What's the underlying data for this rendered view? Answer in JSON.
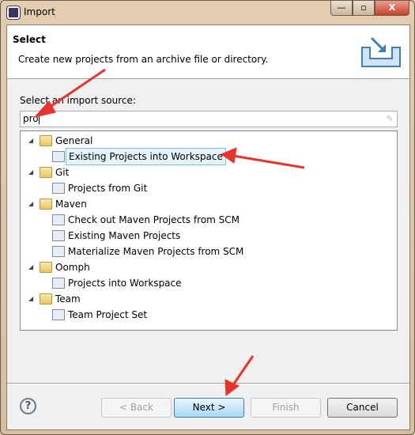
{
  "window": {
    "title": "Import",
    "minimize": "—",
    "maximize": "▫",
    "close": "X"
  },
  "header": {
    "title": "Select",
    "description": "Create new projects from an archive file or directory.",
    "icon": "import-wizard-icon"
  },
  "source": {
    "label": "Select an import source:",
    "filter_value": "pro"
  },
  "tree": [
    {
      "label": "General",
      "level": 0,
      "type": "folder",
      "expanded": true
    },
    {
      "label": "Existing Projects into Workspace",
      "level": 1,
      "type": "item",
      "selected": true
    },
    {
      "label": "Git",
      "level": 0,
      "type": "folder",
      "expanded": true
    },
    {
      "label": "Projects from Git",
      "level": 1,
      "type": "item"
    },
    {
      "label": "Maven",
      "level": 0,
      "type": "folder",
      "expanded": true
    },
    {
      "label": "Check out Maven Projects from SCM",
      "level": 1,
      "type": "item"
    },
    {
      "label": "Existing Maven Projects",
      "level": 1,
      "type": "item"
    },
    {
      "label": "Materialize Maven Projects from SCM",
      "level": 1,
      "type": "item"
    },
    {
      "label": "Oomph",
      "level": 0,
      "type": "folder",
      "expanded": true
    },
    {
      "label": "Projects into Workspace",
      "level": 1,
      "type": "item"
    },
    {
      "label": "Team",
      "level": 0,
      "type": "folder",
      "expanded": true
    },
    {
      "label": "Team Project Set",
      "level": 1,
      "type": "item"
    }
  ],
  "buttons": {
    "help": "?",
    "back": "< Back",
    "next": "Next >",
    "finish": "Finish",
    "cancel": "Cancel"
  },
  "annotation_color": "#e8322a"
}
